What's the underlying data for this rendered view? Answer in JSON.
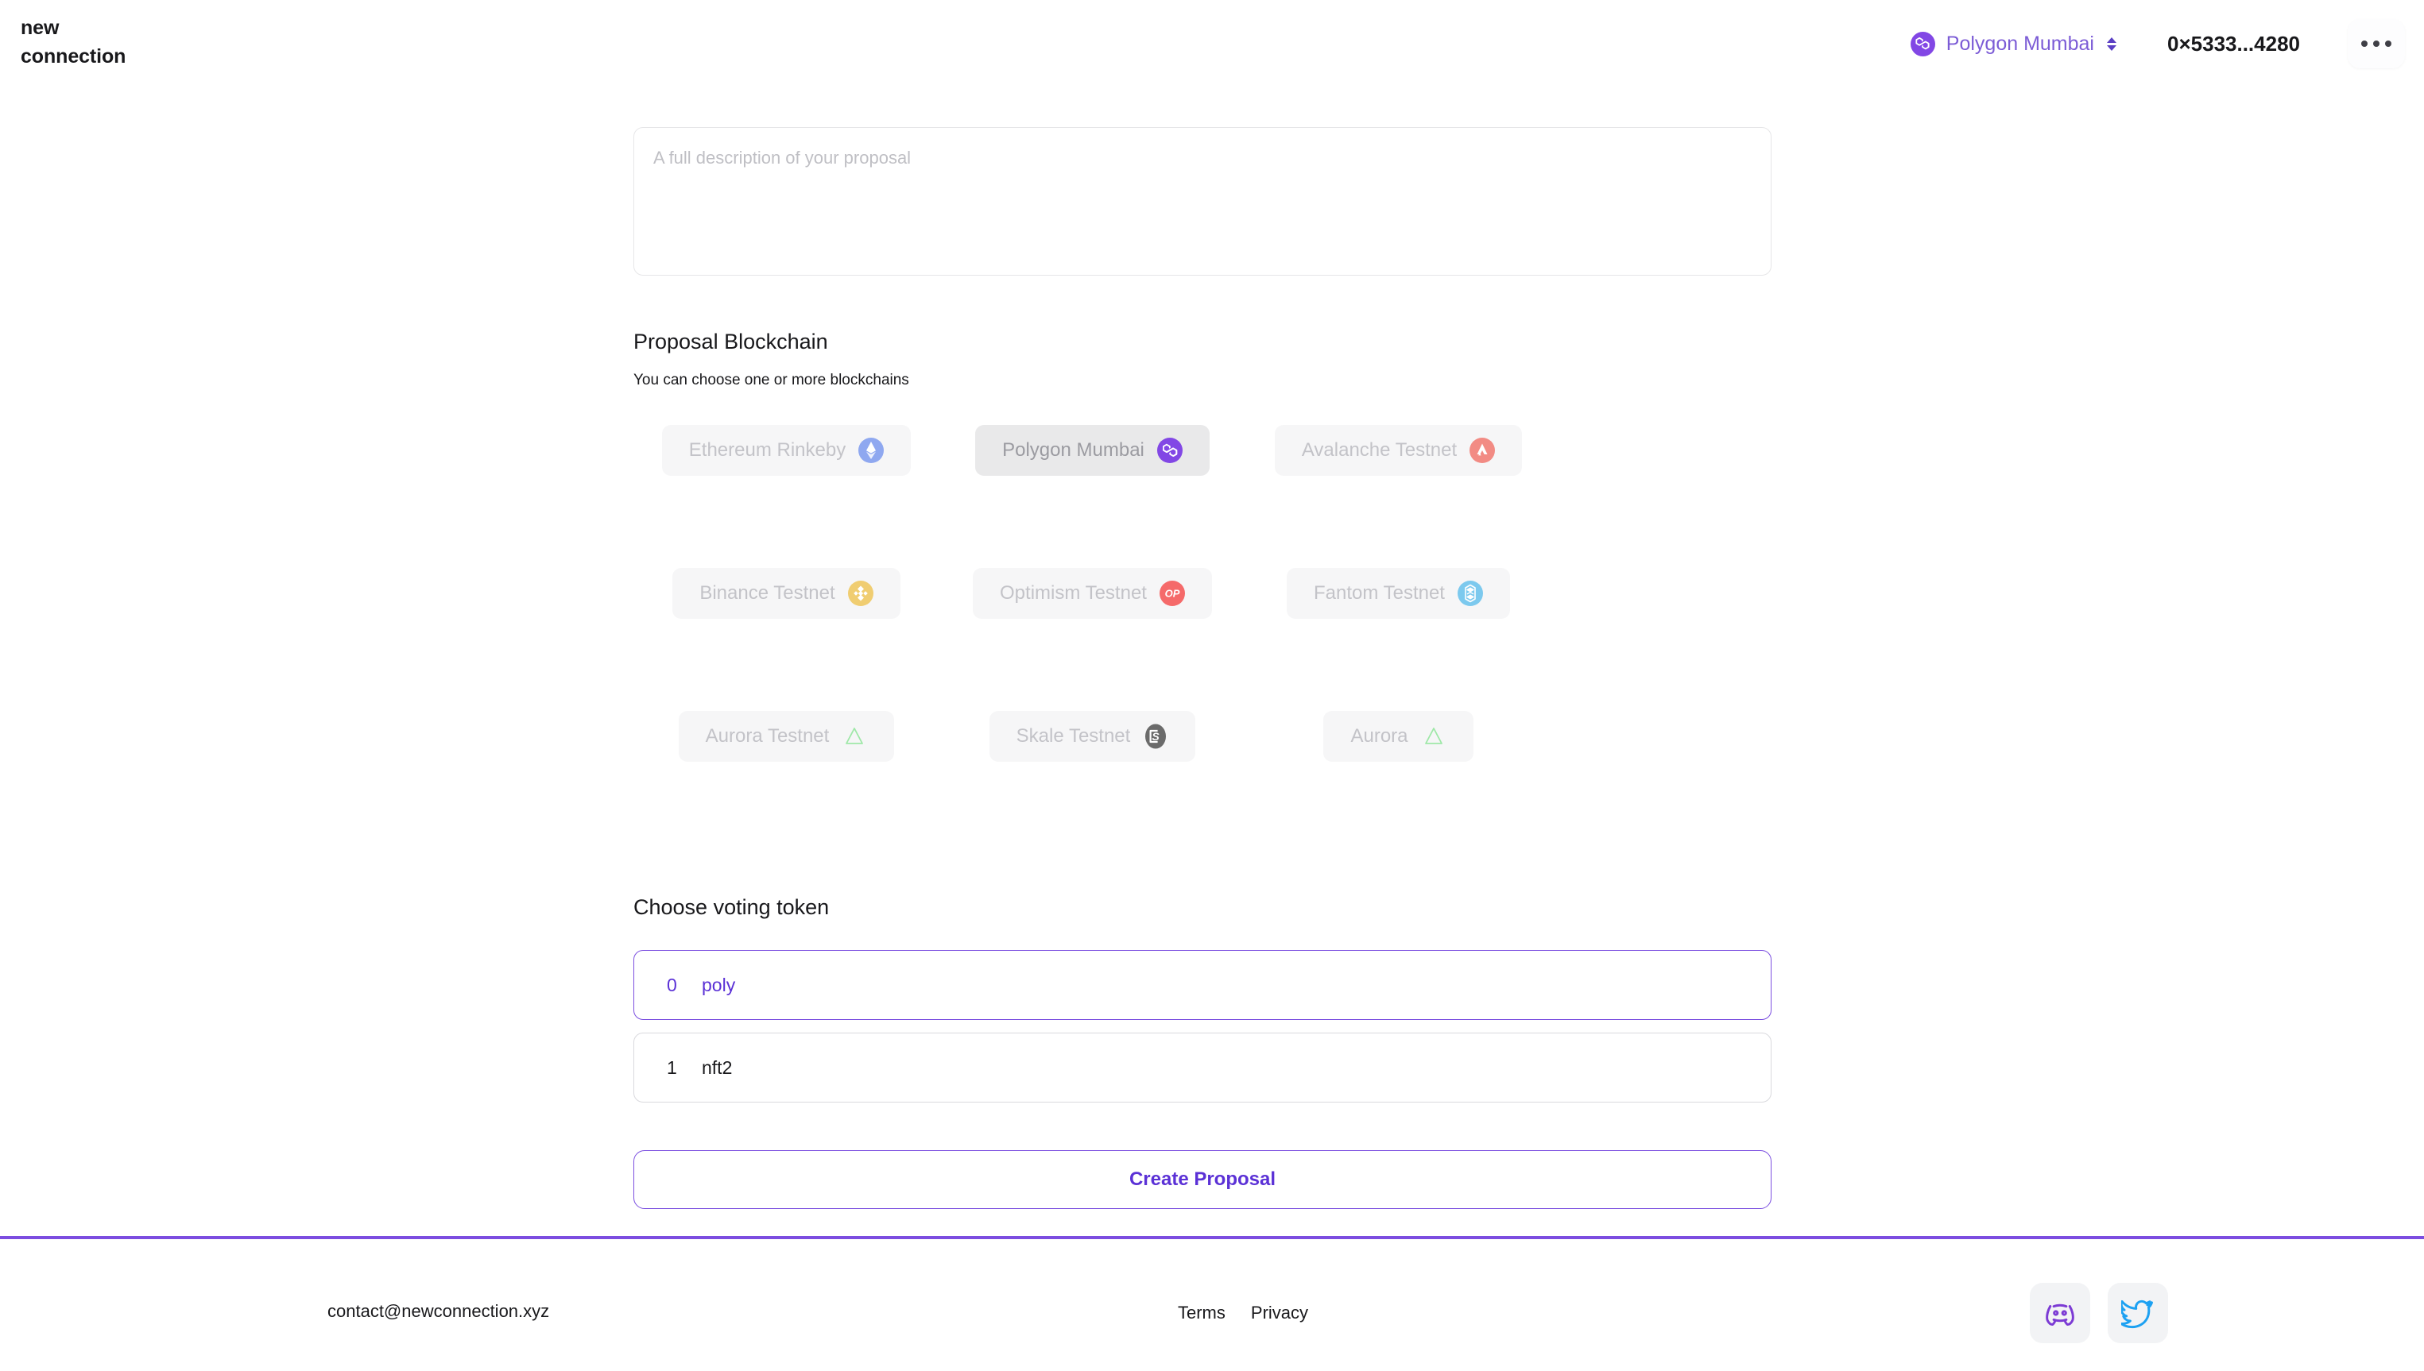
{
  "brand": {
    "line1": "new",
    "line2": "connection"
  },
  "header": {
    "network_name": "Polygon Mumbai",
    "network_icon": "polygon-icon",
    "selector_icon": "chevron-up-down-icon",
    "wallet_address": "0×5333...4280",
    "overflow_icon": "ellipsis-icon"
  },
  "form": {
    "description": {
      "value": "",
      "placeholder": "A full description of your proposal"
    },
    "blockchain_section": {
      "title": "Proposal Blockchain",
      "subtitle": "You can choose one or more blockchains"
    },
    "chains": [
      {
        "label": "Ethereum Rinkeby",
        "icon": "ethereum-icon",
        "selected": false,
        "color": "#8fa8f0"
      },
      {
        "label": "Polygon Mumbai",
        "icon": "polygon-icon",
        "selected": true,
        "color": "#8247e5"
      },
      {
        "label": "Avalanche Testnet",
        "icon": "avalanche-icon",
        "selected": false,
        "color": "#f28b84"
      },
      {
        "label": "Binance Testnet",
        "icon": "binance-icon",
        "selected": false,
        "color": "#f0cd71"
      },
      {
        "label": "Optimism Testnet",
        "icon": "optimism-icon",
        "selected": false,
        "color": "#f56a6a"
      },
      {
        "label": "Fantom Testnet",
        "icon": "fantom-icon",
        "selected": false,
        "color": "#7cc9ee"
      },
      {
        "label": "Aurora Testnet",
        "icon": "aurora-icon",
        "selected": false,
        "color": "#9fe8a8"
      },
      {
        "label": "Skale Testnet",
        "icon": "skale-icon",
        "selected": false,
        "color": "#6b6b6b"
      },
      {
        "label": "Aurora",
        "icon": "aurora-icon",
        "selected": false,
        "color": "#9fe8a8"
      }
    ],
    "token_section": {
      "title": "Choose voting token"
    },
    "tokens": [
      {
        "index": "0",
        "name": "poly",
        "selected": true
      },
      {
        "index": "1",
        "name": "nft2",
        "selected": false
      }
    ],
    "submit_label": "Create Proposal"
  },
  "footer": {
    "email": "contact@newconnection.xyz",
    "links": [
      {
        "label": "Terms"
      },
      {
        "label": "Privacy"
      }
    ],
    "social": [
      {
        "name": "discord-icon",
        "color": "#7c3bd4"
      },
      {
        "name": "twitter-icon",
        "color": "#1da1f2"
      }
    ]
  },
  "colors": {
    "accent": "#7c4de0",
    "accent_text": "#5b31d6",
    "chip_bg": "#f6f6f7",
    "chip_bg_selected": "#e9e9ea"
  }
}
